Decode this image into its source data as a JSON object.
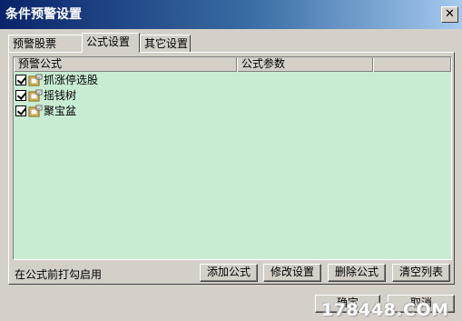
{
  "window": {
    "title": "条件预警设置",
    "close_label": "✕"
  },
  "tabs": [
    {
      "label": "预警股票",
      "active": false
    },
    {
      "label": "公式设置",
      "active": true
    },
    {
      "label": "其它设置",
      "active": false
    }
  ],
  "table": {
    "columns": [
      "预警公式",
      "公式参数",
      ""
    ],
    "rows": [
      {
        "checked": true,
        "icon": "formula-icon",
        "name": "抓涨停选股"
      },
      {
        "checked": true,
        "icon": "formula-icon",
        "name": "摇钱树"
      },
      {
        "checked": true,
        "icon": "formula-icon",
        "name": "聚宝盆"
      }
    ]
  },
  "hint": "在公式前打勾启用",
  "buttons": {
    "add": "添加公式",
    "edit": "修改设置",
    "delete": "删除公式",
    "clear": "清空列表",
    "ok": "确定",
    "cancel": "取消"
  },
  "watermark": "178448.COM",
  "colors": {
    "list_bg": "#c8ecd2",
    "title_start": "#0a246a",
    "title_end": "#a6caf0",
    "dialog_bg": "#d4d0c8"
  }
}
